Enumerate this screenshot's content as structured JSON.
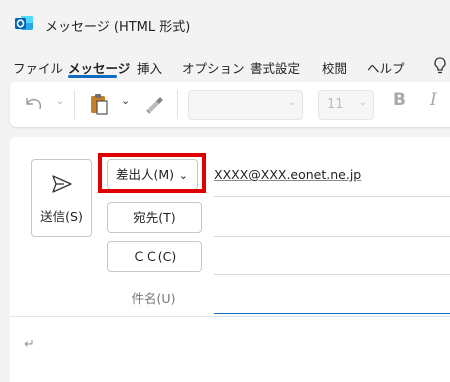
{
  "window": {
    "title": "メッセージ (HTML 形式)"
  },
  "menu": {
    "items": [
      "ファイル",
      "メッセージ",
      "挿入",
      "オプション",
      "書式設定",
      "校閲",
      "ヘルプ"
    ],
    "active": "メッセージ"
  },
  "ribbon": {
    "font_size": "11",
    "bold": "B",
    "italic": "I"
  },
  "compose": {
    "send_label": "送信(S)",
    "from_label": "差出人(M)",
    "from_address": "XXXX@XXX.eonet.ne.jp",
    "to_label": "宛先(T)",
    "cc_label": "ＣＣ(C)",
    "subject_label": "件名(U)",
    "paragraph_mark": "↵"
  },
  "colors": {
    "accent": "#0f6cbd",
    "highlight": "#e00000",
    "outlook_blue": "#0364b8"
  }
}
